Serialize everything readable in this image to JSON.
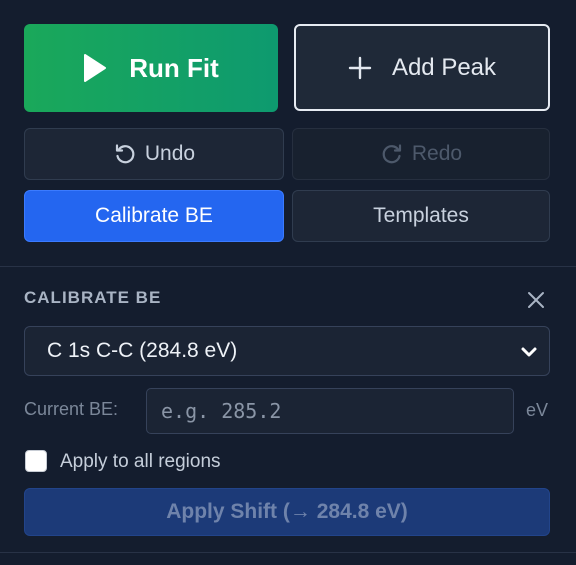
{
  "actions": {
    "run_fit_label": "Run Fit",
    "add_peak_label": "Add Peak",
    "undo_label": "Undo",
    "redo_label": "Redo",
    "calibrate_label": "Calibrate BE",
    "templates_label": "Templates"
  },
  "calibrate": {
    "section_title": "CALIBRATE BE",
    "reference_selected": "C 1s C-C (284.8 eV)",
    "current_be_label": "Current BE:",
    "current_be_value": "",
    "current_be_placeholder": "e.g. 285.2",
    "unit": "eV",
    "apply_all_label": "Apply to all regions",
    "apply_all_checked": false,
    "apply_button_label": "Apply Shift (→ 284.8 eV)",
    "apply_button_enabled": false
  },
  "icons": {
    "run": "play-icon",
    "add": "plus-icon",
    "undo": "undo-icon",
    "redo": "redo-icon",
    "close": "close-icon",
    "dropdown": "chevron-down-icon"
  },
  "colors": {
    "background": "#141d2e",
    "run_gradient_start": "#1aa85a",
    "run_gradient_end": "#0e9a6f",
    "active_blue": "#2466f0",
    "disabled_apply": "#1c3a78"
  },
  "state": {
    "redo_enabled": false,
    "active_tool": "calibrate"
  }
}
